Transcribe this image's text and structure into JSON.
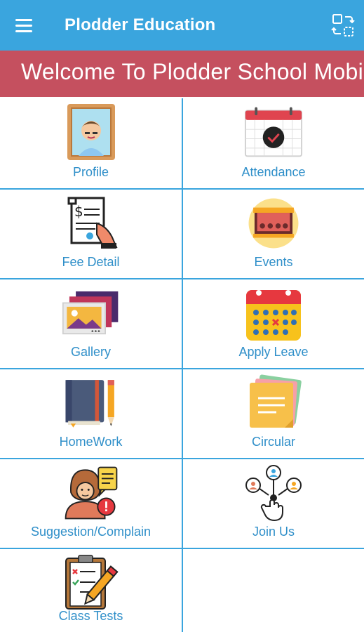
{
  "topbar": {
    "title": "Plodder Education",
    "menu_icon": "hamburger-menu-icon",
    "switch_icon": "switch-account-icon",
    "color": "#3aa5de"
  },
  "banner": {
    "text": "Welcome To Plodder School Mobi",
    "color": "#c5505f"
  },
  "tiles": [
    {
      "label": "Profile",
      "icon": "profile-portrait-icon"
    },
    {
      "label": "Attendance",
      "icon": "calendar-check-icon"
    },
    {
      "label": "Fee Detail",
      "icon": "fee-receipt-icon"
    },
    {
      "label": "Events",
      "icon": "events-stage-icon"
    },
    {
      "label": "Gallery",
      "icon": "gallery-photos-icon"
    },
    {
      "label": "Apply Leave",
      "icon": "leave-calendar-icon"
    },
    {
      "label": "HomeWork",
      "icon": "homework-notebook-icon"
    },
    {
      "label": "Circular",
      "icon": "circular-notes-icon"
    },
    {
      "label": "Suggestion/Complain",
      "icon": "suggestion-complain-icon"
    },
    {
      "label": "Join Us",
      "icon": "join-us-network-icon"
    },
    {
      "label": "Class Tests",
      "icon": "class-tests-clipboard-icon"
    }
  ],
  "colors": {
    "label": "#2f8fc9",
    "grid_line": "#3aa5de"
  }
}
